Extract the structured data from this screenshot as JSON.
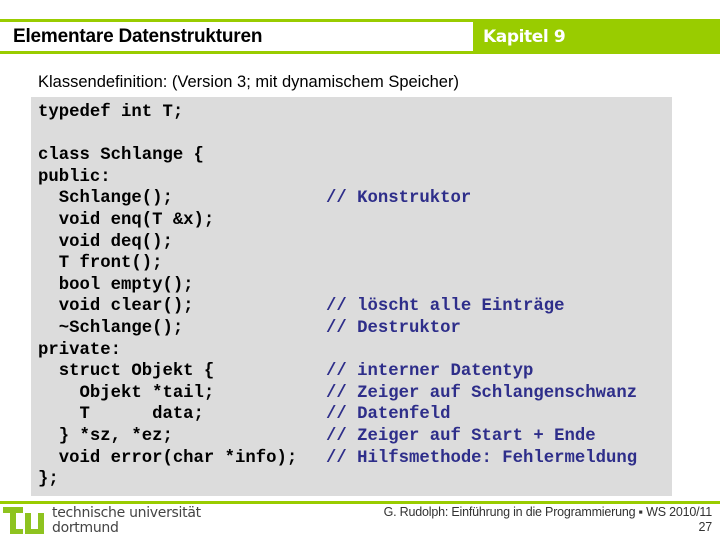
{
  "header": {
    "title": "Elementare Datenstrukturen",
    "chapter": "Kapitel 9"
  },
  "subtitle": "Klassendefinition: (Version 3; mit dynamischem Speicher)",
  "code": {
    "lines": [
      {
        "code": "typedef int T;",
        "comment": ""
      },
      {
        "code": "",
        "comment": ""
      },
      {
        "code": "class Schlange {",
        "comment": ""
      },
      {
        "code": "public:",
        "comment": ""
      },
      {
        "code": "  Schlange();",
        "comment": "// Konstruktor"
      },
      {
        "code": "  void enq(T &x);",
        "comment": ""
      },
      {
        "code": "  void deq();",
        "comment": ""
      },
      {
        "code": "  T front();",
        "comment": ""
      },
      {
        "code": "  bool empty();",
        "comment": ""
      },
      {
        "code": "  void clear();",
        "comment": "// löscht alle Einträge"
      },
      {
        "code": "  ~Schlange();",
        "comment": "// Destruktor"
      },
      {
        "code": "private:",
        "comment": ""
      },
      {
        "code": "  struct Objekt {",
        "comment": "// interner Datentyp"
      },
      {
        "code": "    Objekt *tail;",
        "comment": "// Zeiger auf Schlangenschwanz"
      },
      {
        "code": "    T      data;",
        "comment": "// Datenfeld"
      },
      {
        "code": "  } *sz, *ez;",
        "comment": "// Zeiger auf Start + Ende"
      },
      {
        "code": "  void error(char *info);",
        "comment": "// Hilfsmethode: Fehlermeldung"
      },
      {
        "code": "};",
        "comment": ""
      }
    ]
  },
  "footer": {
    "university_line1": "technische universität",
    "university_line2": "dortmund",
    "credit": "G. Rudolph: Einführung in die Programmierung ▪ WS 2010/11",
    "page_number": "27"
  },
  "colors": {
    "accent": "#99cc00",
    "comment": "#2e2e8a",
    "code_background": "#dcdcdc"
  }
}
